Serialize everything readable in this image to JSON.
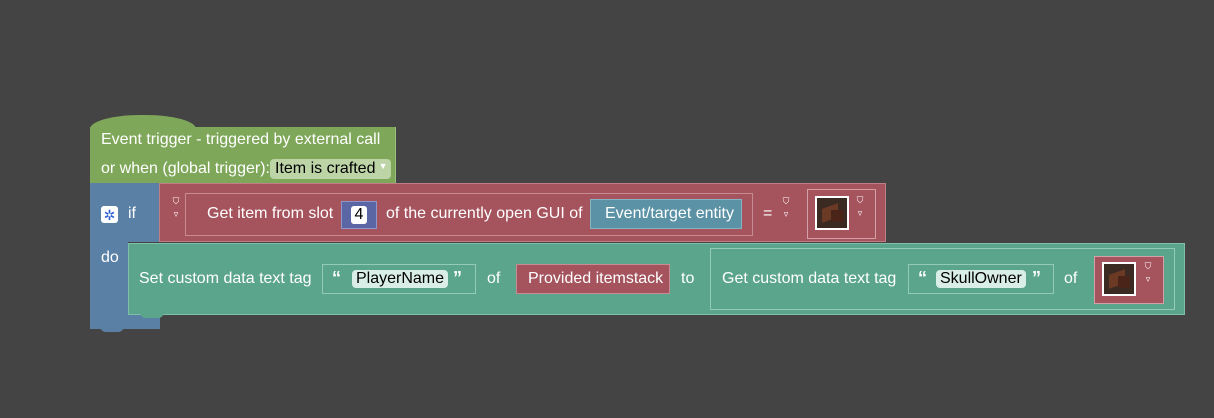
{
  "event_block": {
    "line1": "Event trigger - triggered by external call",
    "line2": "or when (global trigger):",
    "trigger_value": "Item is crafted"
  },
  "if_block": {
    "if_label": "if",
    "do_label": "do"
  },
  "condition": {
    "get_item_label": "Get item from slot",
    "slot_number": "4",
    "gui_label": "of the currently open GUI of",
    "entity": "Event/target entity",
    "equals": "="
  },
  "statement": {
    "set_label": "Set custom data text tag",
    "tag_name": "PlayerName",
    "of_label": "of",
    "itemstack": "Provided itemstack",
    "to_label": "to",
    "get_label": "Get custom data text tag",
    "get_tag_name": "SkullOwner",
    "of_label2": "of"
  },
  "glyphs": {
    "open_quote": "“",
    "close_quote": "”",
    "gear": "✲",
    "dropdown_arrow": "▼",
    "mini_icon_top": "⛉",
    "mini_icon_bottom": "▿"
  },
  "icons": [
    "gear-icon",
    "dropdown-arrow-icon",
    "skull-item-icon",
    "quote-open-icon",
    "quote-close-icon"
  ],
  "colors": {
    "workspace": "#444444",
    "event": "#7fa75a",
    "control": "#5b80a5",
    "item": "#a5535d",
    "text_data": "#5ba58c",
    "math": "#5b67a5",
    "entity": "#5b92a5"
  }
}
